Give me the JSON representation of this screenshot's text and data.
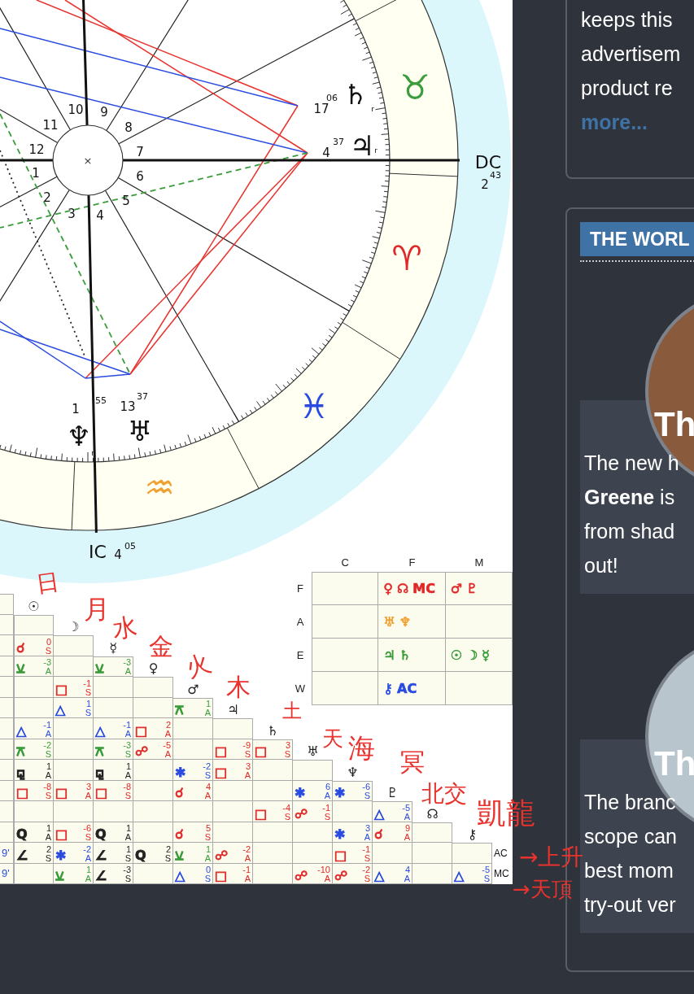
{
  "chart": {
    "center_mark": "×",
    "house_numbers": [
      "1",
      "2",
      "3",
      "4",
      "5",
      "6",
      "7",
      "8",
      "9",
      "10",
      "11",
      "12"
    ],
    "signs": [
      {
        "glyph": "♉",
        "color": "#3a9c3a"
      },
      {
        "glyph": "♈",
        "color": "#e02828"
      },
      {
        "glyph": "♓",
        "color": "#2a4be0"
      },
      {
        "glyph": "♒",
        "color": "#f0a030"
      }
    ],
    "planets": [
      {
        "glyph": "♄",
        "degree": "17",
        "minutes": "06",
        "retrograde_mark": "r"
      },
      {
        "glyph": "♃",
        "degree": "4",
        "minutes": "37",
        "retrograde_mark": "r"
      },
      {
        "glyph": "♆",
        "degree": "1",
        "minutes": "55",
        "retrograde_mark": "r"
      },
      {
        "glyph": "♅",
        "degree": "13",
        "minutes": "37"
      }
    ],
    "axes": [
      {
        "label": "DC",
        "degree": "2",
        "minutes": "43"
      },
      {
        "label": "IC",
        "degree": "4",
        "minutes": "05"
      }
    ]
  },
  "element_table": {
    "columns": [
      "C",
      "F",
      "M"
    ],
    "rows": [
      {
        "label": "F",
        "cells": [
          [],
          [
            {
              "text": "♀",
              "color": "#e02828"
            },
            {
              "text": "☊",
              "color": "#e02828"
            },
            {
              "text": "MC",
              "color": "#e02828"
            }
          ],
          [
            {
              "text": "♂",
              "color": "#e02828"
            },
            {
              "text": "♇",
              "color": "#e02828"
            }
          ]
        ]
      },
      {
        "label": "A",
        "cells": [
          [],
          [
            {
              "text": "♅",
              "color": "#f0a030"
            },
            {
              "text": "♆",
              "color": "#f0a030"
            }
          ],
          []
        ]
      },
      {
        "label": "E",
        "cells": [
          [],
          [
            {
              "text": "♃",
              "color": "#3a9c3a"
            },
            {
              "text": "♄",
              "color": "#3a9c3a"
            }
          ],
          [
            {
              "text": "☉",
              "color": "#3a9c3a"
            },
            {
              "text": "☽",
              "color": "#3a9c3a"
            },
            {
              "text": "☿",
              "color": "#3a9c3a"
            }
          ]
        ]
      },
      {
        "label": "W",
        "cells": [
          [],
          [
            {
              "text": "⚷",
              "color": "#2a4be0"
            },
            {
              "text": "AC",
              "color": "#2a4be0"
            }
          ],
          []
        ]
      }
    ]
  },
  "aspect_grid": {
    "diagonal_planet_glyphs": [
      "☉",
      "☽",
      "☿",
      "♀",
      "♂",
      "♃",
      "♄",
      "♅",
      "♆",
      "♇",
      "☊",
      "⚷"
    ],
    "rows": [
      {
        "cells": [
          {
            "symbol": "☌",
            "orb": "0",
            "mode": "S",
            "color": "#e02828"
          },
          null
        ]
      },
      {
        "cells": [
          {
            "symbol": "⚺",
            "orb": "-3",
            "mode": "A",
            "color": "#3a9c3a"
          },
          null,
          {
            "symbol": "⚺",
            "orb": "-3",
            "mode": "A",
            "color": "#3a9c3a"
          }
        ]
      },
      {
        "cells": [
          null,
          {
            "symbol": "□",
            "orb": "-1",
            "mode": "S",
            "color": "#e02828"
          },
          null,
          null
        ]
      },
      {
        "cells": [
          null,
          {
            "symbol": "△",
            "orb": "1",
            "mode": "S",
            "color": "#2a4be0"
          },
          null,
          null,
          {
            "symbol": "⚻",
            "orb": "1",
            "mode": "A",
            "color": "#3a9c3a"
          }
        ]
      },
      {
        "cells": [
          {
            "symbol": "△",
            "orb": "-1",
            "mode": "A",
            "color": "#2a4be0"
          },
          null,
          {
            "symbol": "△",
            "orb": "-1",
            "mode": "A",
            "color": "#2a4be0"
          },
          {
            "symbol": "□",
            "orb": "2",
            "mode": "A",
            "color": "#e02828"
          },
          null,
          null
        ]
      },
      {
        "cells": [
          {
            "symbol": "⚻",
            "orb": "-2",
            "mode": "S",
            "color": "#3a9c3a"
          },
          null,
          {
            "symbol": "⚻",
            "orb": "-3",
            "mode": "S",
            "color": "#3a9c3a"
          },
          {
            "symbol": "☍",
            "orb": "-5",
            "mode": "A",
            "color": "#e02828"
          },
          null,
          {
            "symbol": "□",
            "orb": "-9",
            "mode": "S",
            "color": "#e02828"
          },
          {
            "symbol": "□",
            "orb": "3",
            "mode": "S",
            "color": "#e02828"
          }
        ]
      },
      {
        "cells": [
          {
            "symbol": "⚼",
            "orb": "1",
            "mode": "A",
            "color": "#222222"
          },
          null,
          {
            "symbol": "⚼",
            "orb": "1",
            "mode": "A",
            "color": "#222222"
          },
          null,
          {
            "symbol": "✱",
            "orb": "-2",
            "mode": "S",
            "color": "#2a4be0"
          },
          {
            "symbol": "□",
            "orb": "3",
            "mode": "A",
            "color": "#e02828"
          },
          null,
          null
        ]
      },
      {
        "cells": [
          {
            "symbol": "□",
            "orb": "-8",
            "mode": "S",
            "color": "#e02828"
          },
          {
            "symbol": "□",
            "orb": "3",
            "mode": "A",
            "color": "#e02828"
          },
          {
            "symbol": "□",
            "orb": "-8",
            "mode": "S",
            "color": "#e02828"
          },
          null,
          {
            "symbol": "☌",
            "orb": "4",
            "mode": "A",
            "color": "#e02828"
          },
          null,
          null,
          {
            "symbol": "✱",
            "orb": "6",
            "mode": "A",
            "color": "#2a4be0"
          },
          {
            "symbol": "✱",
            "orb": "-6",
            "mode": "S",
            "color": "#2a4be0"
          }
        ]
      },
      {
        "cells": [
          null,
          null,
          null,
          null,
          null,
          null,
          {
            "symbol": "□",
            "orb": "-4",
            "mode": "S",
            "color": "#e02828"
          },
          {
            "symbol": "☍",
            "orb": "-1",
            "mode": "S",
            "color": "#e02828"
          },
          null,
          {
            "symbol": "△",
            "orb": "-5",
            "mode": "A",
            "color": "#2a4be0"
          }
        ]
      },
      {
        "cells": [
          {
            "symbol": "Q",
            "orb": "1",
            "mode": "A",
            "color": "#222222"
          },
          {
            "symbol": "□",
            "orb": "-6",
            "mode": "S",
            "color": "#e02828"
          },
          {
            "symbol": "Q",
            "orb": "1",
            "mode": "A",
            "color": "#222222"
          },
          null,
          {
            "symbol": "☌",
            "orb": "5",
            "mode": "S",
            "color": "#e02828"
          },
          null,
          null,
          null,
          {
            "symbol": "✱",
            "orb": "3",
            "mode": "A",
            "color": "#2a4be0"
          },
          {
            "symbol": "☌",
            "orb": "9",
            "mode": "A",
            "color": "#e02828"
          },
          null
        ]
      },
      {
        "label": "AC",
        "left_value": "9'",
        "cells": [
          {
            "symbol": "∠",
            "orb": "2",
            "mode": "S",
            "color": "#222222"
          },
          {
            "symbol": "✱",
            "orb": "-2",
            "mode": "A",
            "color": "#2a4be0"
          },
          {
            "symbol": "∠",
            "orb": "1",
            "mode": "S",
            "color": "#222222"
          },
          {
            "symbol": "Q",
            "orb": "2",
            "mode": "S",
            "color": "#222222"
          },
          {
            "symbol": "⚺",
            "orb": "1",
            "mode": "A",
            "color": "#3a9c3a"
          },
          {
            "symbol": "☍",
            "orb": "-2",
            "mode": "A",
            "color": "#e02828"
          },
          null,
          null,
          {
            "symbol": "□",
            "orb": "-1",
            "mode": "S",
            "color": "#e02828"
          },
          null,
          null,
          null
        ]
      },
      {
        "label": "MC",
        "left_value": "9'",
        "cells": [
          null,
          {
            "symbol": "⚺",
            "orb": "1",
            "mode": "A",
            "color": "#3a9c3a"
          },
          {
            "symbol": "∠",
            "orb": "-3",
            "mode": "S",
            "color": "#222222"
          },
          null,
          {
            "symbol": "△",
            "orb": "0",
            "mode": "S",
            "color": "#2a4be0"
          },
          {
            "symbol": "□",
            "orb": "-1",
            "mode": "A",
            "color": "#e02828"
          },
          null,
          {
            "symbol": "☍",
            "orb": "-10",
            "mode": "A",
            "color": "#e02828"
          },
          {
            "symbol": "☍",
            "orb": "-2",
            "mode": "S",
            "color": "#e02828"
          },
          {
            "symbol": "△",
            "orb": "4",
            "mode": "A",
            "color": "#2a4be0"
          },
          null,
          {
            "symbol": "△",
            "orb": "-5",
            "mode": "S",
            "color": "#2a4be0"
          }
        ]
      }
    ]
  },
  "handwritten_notes": [
    "日",
    "月",
    "水",
    "金",
    "火",
    "木",
    "土",
    "天",
    "海",
    "冥",
    "北交",
    "凱龍",
    "→上升",
    "→天頂"
  ],
  "sidebar": {
    "info_box": {
      "lines": [
        "keeps this",
        "advertisem",
        "product re"
      ],
      "link": "more..."
    },
    "feature_box": {
      "heading": "THE WORL",
      "cards": [
        {
          "title": "Th",
          "lines": [
            "The new h",
            "**Greene** is",
            "from shad",
            "out!"
          ]
        },
        {
          "title": "Th",
          "lines": [
            "The branc",
            "scope can",
            "best mom",
            "try-out ver"
          ]
        }
      ]
    }
  }
}
